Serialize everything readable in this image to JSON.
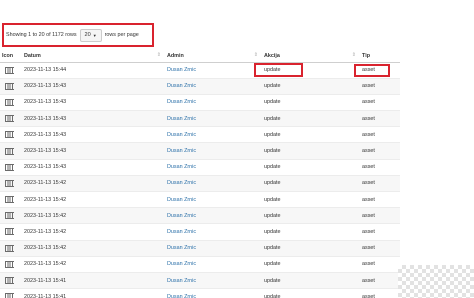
{
  "pagination": {
    "summary": "Showing 1 to 20 of 1172 rows",
    "page_size": "20",
    "suffix": "rows per page"
  },
  "table": {
    "headers": {
      "icon": "Icon",
      "date": "Datum",
      "admin": "Admin",
      "action": "Akcija",
      "type": "Tip"
    },
    "rows": [
      {
        "date": "2023-11-13 15:44",
        "admin": "Dusan Zrnic",
        "action": "update",
        "type": "asset"
      },
      {
        "date": "2023-11-13 15:43",
        "admin": "Dusan Zrnic",
        "action": "update",
        "type": "asset"
      },
      {
        "date": "2023-11-13 15:43",
        "admin": "Dusan Zrnic",
        "action": "update",
        "type": "asset"
      },
      {
        "date": "2023-11-13 15:43",
        "admin": "Dusan Zrnic",
        "action": "update",
        "type": "asset"
      },
      {
        "date": "2023-11-13 15:43",
        "admin": "Dusan Zrnic",
        "action": "update",
        "type": "asset"
      },
      {
        "date": "2023-11-13 15:43",
        "admin": "Dusan Zrnic",
        "action": "update",
        "type": "asset"
      },
      {
        "date": "2023-11-13 15:43",
        "admin": "Dusan Zrnic",
        "action": "update",
        "type": "asset"
      },
      {
        "date": "2023-11-13 15:42",
        "admin": "Dusan Zrnic",
        "action": "update",
        "type": "asset"
      },
      {
        "date": "2023-11-13 15:42",
        "admin": "Dusan Zrnic",
        "action": "update",
        "type": "asset"
      },
      {
        "date": "2023-11-13 15:42",
        "admin": "Dusan Zrnic",
        "action": "update",
        "type": "asset"
      },
      {
        "date": "2023-11-13 15:42",
        "admin": "Dusan Zrnic",
        "action": "update",
        "type": "asset"
      },
      {
        "date": "2023-11-13 15:42",
        "admin": "Dusan Zrnic",
        "action": "update",
        "type": "asset"
      },
      {
        "date": "2023-11-13 15:42",
        "admin": "Dusan Zrnic",
        "action": "update",
        "type": "asset"
      },
      {
        "date": "2023-11-13 15:41",
        "admin": "Dusan Zrnic",
        "action": "update",
        "type": "asset"
      },
      {
        "date": "2023-11-13 15:41",
        "admin": "Dusan Zrnic",
        "action": "update",
        "type": "asset"
      }
    ]
  },
  "icons": {
    "row_icon": "barcode-icon",
    "sort_icon": "sort-arrows-icon",
    "dropdown_icon": "caret-down-icon"
  },
  "colors": {
    "highlight": "#d9232e",
    "admin_link": "#2a6fa8"
  }
}
